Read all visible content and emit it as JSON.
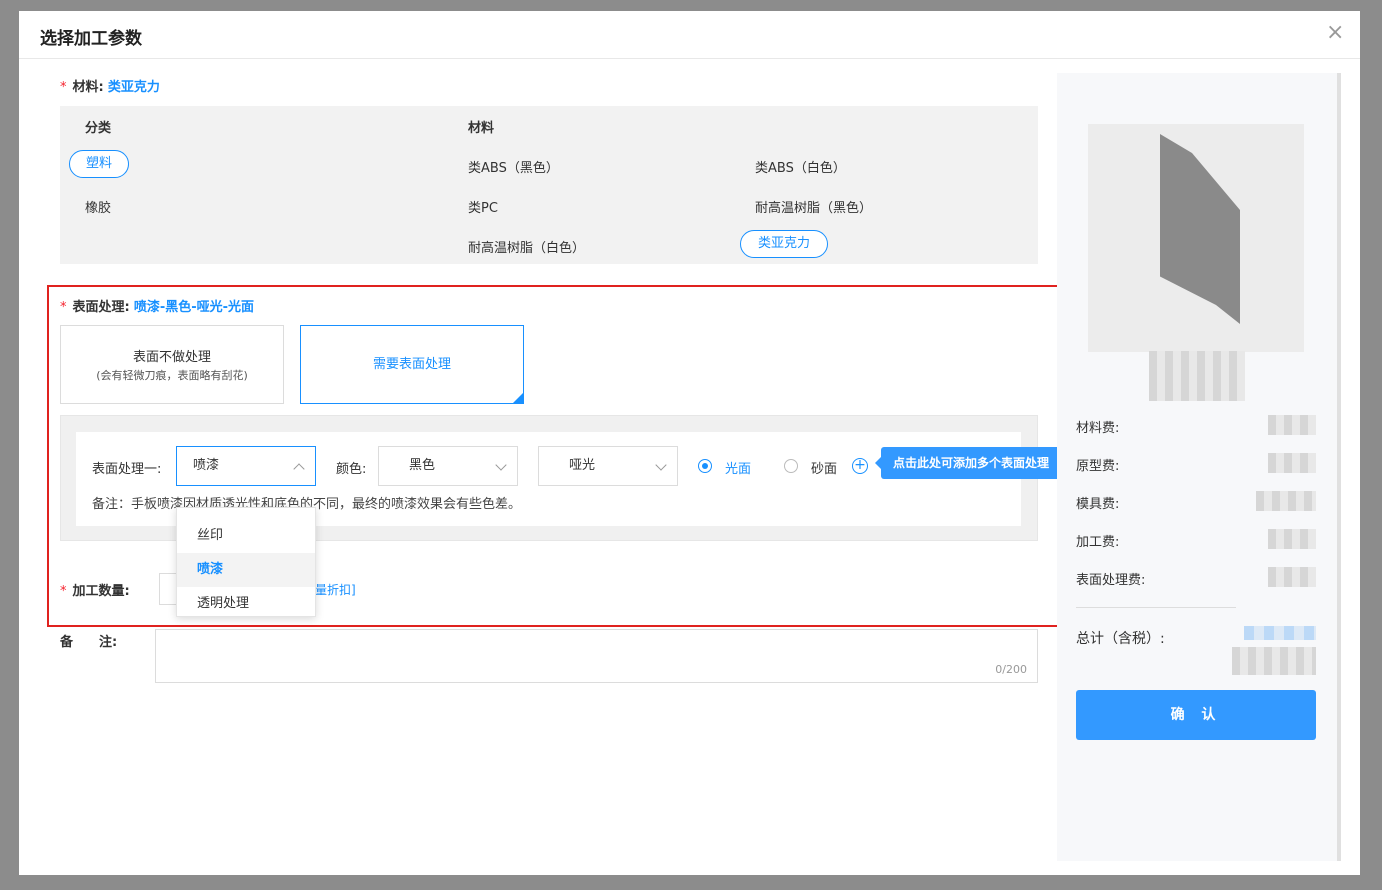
{
  "dialog": {
    "title": "选择加工参数",
    "close_icon": "close-icon"
  },
  "material": {
    "label": "材料:",
    "selected": "类亚克力",
    "col_category": "分类",
    "col_material": "材料",
    "categories": [
      "塑料",
      "橡胶"
    ],
    "selected_category": "塑料",
    "materials": [
      "类ABS（黑色）",
      "类ABS（白色）",
      "类PC",
      "耐高温树脂（黑色）",
      "耐高温树脂（白色）",
      "类亚克力"
    ]
  },
  "surface": {
    "label": "表面处理:",
    "selected": "喷漆-黑色-哑光-光面",
    "option_none_title": "表面不做处理",
    "option_none_desc": "(会有轻微刀痕，表面略有刮花)",
    "option_need": "需要表面处理",
    "row_label": "表面处理一:",
    "process_value": "喷漆",
    "color_label": "颜色:",
    "color_value": "黑色",
    "finish_value": "哑光",
    "radio_glossy": "光面",
    "radio_sand": "砂面",
    "note": "备注：手板喷漆因材质透光性和底色的不同，最终的喷漆效果会有些色差。",
    "tooltip": "点击此处可添加多个表面处理",
    "dropdown_options": [
      "丝印",
      "喷漆",
      "透明处理"
    ],
    "dropdown_selected": "喷漆"
  },
  "quantity": {
    "label": "加工数量:",
    "discount_text": "量折扣]"
  },
  "remark": {
    "label": "备　　注:",
    "counter": "0/200"
  },
  "summary": {
    "material_fee": "材料费:",
    "prototype_fee": "原型费:",
    "mold_fee": "模具费:",
    "process_fee": "加工费:",
    "surface_fee": "表面处理费:",
    "total": "总计（含税）:",
    "confirm": "确 认"
  },
  "colors": {
    "accent": "#1890ff",
    "required": "#f5222d",
    "highlight_border": "#e0221f",
    "button": "#3399ff"
  }
}
